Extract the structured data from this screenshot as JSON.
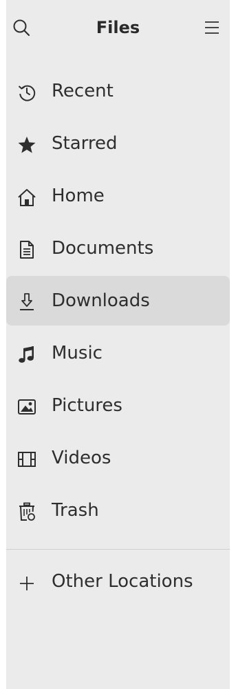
{
  "header": {
    "title": "Files",
    "search_icon": "search-icon",
    "menu_icon": "hamburger-menu-icon"
  },
  "sidebar": {
    "items": [
      {
        "label": "Recent",
        "icon": "clock-history-icon"
      },
      {
        "label": "Starred",
        "icon": "star-icon"
      },
      {
        "label": "Home",
        "icon": "home-icon"
      },
      {
        "label": "Documents",
        "icon": "document-icon"
      },
      {
        "label": "Downloads",
        "icon": "download-icon",
        "selected": true
      },
      {
        "label": "Music",
        "icon": "music-note-icon"
      },
      {
        "label": "Pictures",
        "icon": "picture-icon"
      },
      {
        "label": "Videos",
        "icon": "film-icon"
      },
      {
        "label": "Trash",
        "icon": "trash-icon"
      }
    ],
    "other": {
      "label": "Other Locations",
      "icon": "plus-icon"
    }
  },
  "colors": {
    "sidebar_bg": "#ebebeb",
    "selected_bg": "#dadada",
    "text": "#2e2e2e"
  }
}
